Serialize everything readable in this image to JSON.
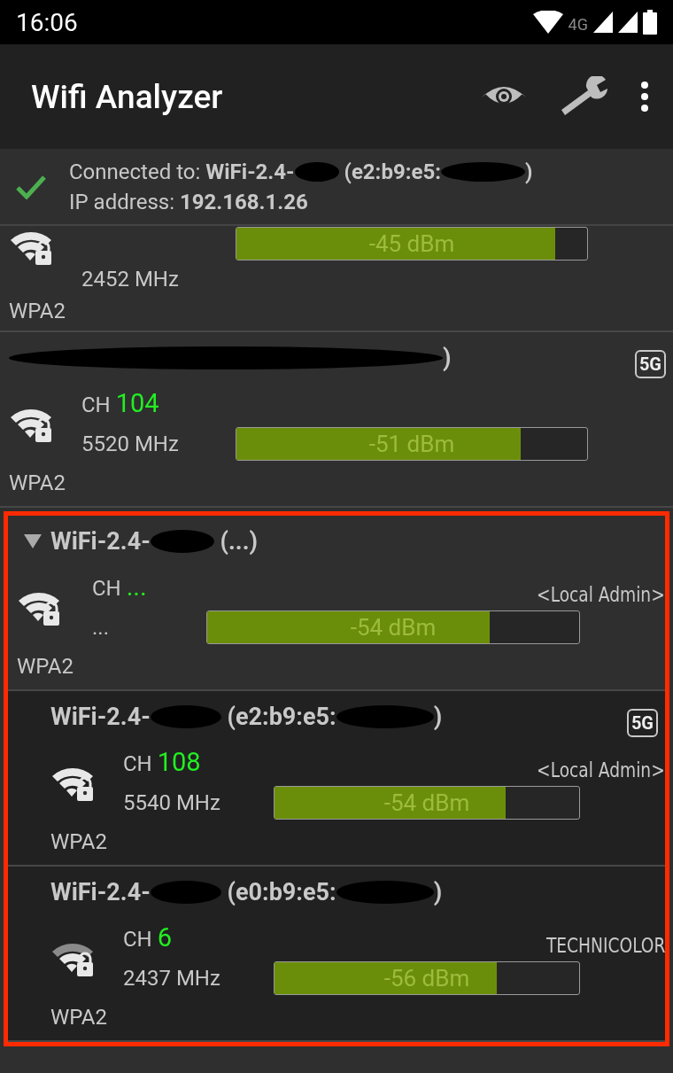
{
  "status_bar": {
    "time": "16:06",
    "network_type": "4G"
  },
  "app_bar": {
    "title": "Wifi Analyzer"
  },
  "connection": {
    "label": "Connected to:",
    "ssid_start": "WiFi-2.4-",
    "bssid_start": "(e2:b9:e5:",
    "bssid_end": ")",
    "ip": "IP address: **192.168.1.26**"
  },
  "networks": [
    {
      "kind": "network",
      "cut_top": true,
      "frequency": "2452 MHz",
      "reading": "-45 dBm",
      "level": 0.91,
      "security": "WPA2"
    },
    {
      "kind": "network",
      "name_end": ")",
      "band": "5G",
      "ch_label": "CH",
      "channel": "104",
      "frequency": "5520 MHz",
      "reading": "-51 dBm",
      "level": 0.81,
      "security": "WPA2"
    },
    {
      "kind": "group",
      "highlight": true,
      "expanded": true,
      "ssid_start": "WiFi-2.4-",
      "name_end": "(...)",
      "ch_label": "CH",
      "channel": "...",
      "frequency": "...",
      "vendor": "<Local Admin>",
      "reading": "-54 dBm",
      "level": 0.76,
      "security": "WPA2",
      "children": [
        {
          "kind": "network",
          "ssid_start": "WiFi-2.4-",
          "bssid_start": "(e2:b9:e5:",
          "name_end": ")",
          "band": "5G",
          "ch_label": "CH",
          "channel": "108",
          "frequency": "5540 MHz",
          "vendor": "<Local Admin>",
          "reading": "-54 dBm",
          "level": 0.76,
          "security": "WPA2"
        },
        {
          "kind": "network",
          "weak": true,
          "ssid_start": "WiFi-2.4-",
          "bssid_start": "(e0:b9:e5:",
          "name_end": ")",
          "ch_label": "CH",
          "channel": "6",
          "frequency": "2437 MHz",
          "vendor": "TECHNICOLOR",
          "reading": "-56 dBm",
          "level": 0.73,
          "security": "WPA2"
        }
      ]
    }
  ]
}
